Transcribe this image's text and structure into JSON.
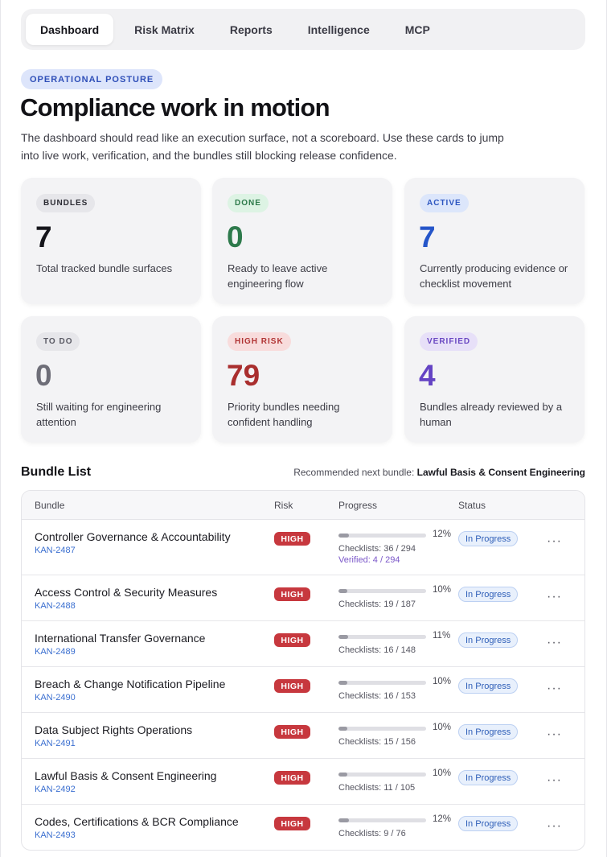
{
  "tabs": [
    "Dashboard",
    "Risk Matrix",
    "Reports",
    "Intelligence",
    "MCP"
  ],
  "hero": {
    "eyebrow": "OPERATIONAL POSTURE",
    "title": "Compliance work in motion",
    "description": "The dashboard should read like an execution surface, not a scoreboard. Use these cards to jump into live work, verification, and the bundles still blocking release confidence."
  },
  "stats": [
    {
      "label": "BUNDLES",
      "value": "7",
      "desc": "Total tracked bundle surfaces",
      "pill_bg": "#e6e6ea",
      "pill_fg": "#2b2b33",
      "num_color": "#15151b"
    },
    {
      "label": "DONE",
      "value": "0",
      "desc": "Ready to leave active engineering flow",
      "pill_bg": "#ddf3e4",
      "pill_fg": "#2d7a4a",
      "num_color": "#2e7a4c"
    },
    {
      "label": "ACTIVE",
      "value": "7",
      "desc": "Currently producing evidence or checklist movement",
      "pill_bg": "#dce6fb",
      "pill_fg": "#2d56c0",
      "num_color": "#2555c9"
    },
    {
      "label": "TO DO",
      "value": "0",
      "desc": "Still waiting for engineering attention",
      "pill_bg": "#e6e6ea",
      "pill_fg": "#5a5a64",
      "num_color": "#6e6e78"
    },
    {
      "label": "HIGH RISK",
      "value": "79",
      "desc": "Priority bundles needing confident handling",
      "pill_bg": "#f8dcdc",
      "pill_fg": "#b03434",
      "num_color": "#a92e2e"
    },
    {
      "label": "VERIFIED",
      "value": "4",
      "desc": "Bundles already reviewed by a human",
      "pill_bg": "#e7e0f8",
      "pill_fg": "#6a48c2",
      "num_color": "#6443c4"
    }
  ],
  "bundle_list": {
    "title": "Bundle List",
    "recommended_prefix": "Recommended next bundle:",
    "recommended_name": "Lawful Basis & Consent Engineering",
    "columns": [
      "Bundle",
      "Risk",
      "Progress",
      "Status"
    ],
    "rows": [
      {
        "name": "Controller Governance & Accountability",
        "key": "KAN-2487",
        "risk": "HIGH",
        "progress": 12,
        "pct": "12%",
        "checklists": "Checklists: 36 / 294",
        "verified": "Verified: 4 / 294",
        "status": "In Progress"
      },
      {
        "name": "Access Control & Security Measures",
        "key": "KAN-2488",
        "risk": "HIGH",
        "progress": 10,
        "pct": "10%",
        "checklists": "Checklists: 19 / 187",
        "verified": null,
        "status": "In Progress"
      },
      {
        "name": "International Transfer Governance",
        "key": "KAN-2489",
        "risk": "HIGH",
        "progress": 11,
        "pct": "11%",
        "checklists": "Checklists: 16 / 148",
        "verified": null,
        "status": "In Progress"
      },
      {
        "name": "Breach & Change Notification Pipeline",
        "key": "KAN-2490",
        "risk": "HIGH",
        "progress": 10,
        "pct": "10%",
        "checklists": "Checklists: 16 / 153",
        "verified": null,
        "status": "In Progress"
      },
      {
        "name": "Data Subject Rights Operations",
        "key": "KAN-2491",
        "risk": "HIGH",
        "progress": 10,
        "pct": "10%",
        "checklists": "Checklists: 15 / 156",
        "verified": null,
        "status": "In Progress"
      },
      {
        "name": "Lawful Basis & Consent Engineering",
        "key": "KAN-2492",
        "risk": "HIGH",
        "progress": 10,
        "pct": "10%",
        "checklists": "Checklists: 11 / 105",
        "verified": null,
        "status": "In Progress"
      },
      {
        "name": "Codes, Certifications & BCR Compliance",
        "key": "KAN-2493",
        "risk": "HIGH",
        "progress": 12,
        "pct": "12%",
        "checklists": "Checklists: 9 / 76",
        "verified": null,
        "status": "In Progress"
      }
    ]
  }
}
